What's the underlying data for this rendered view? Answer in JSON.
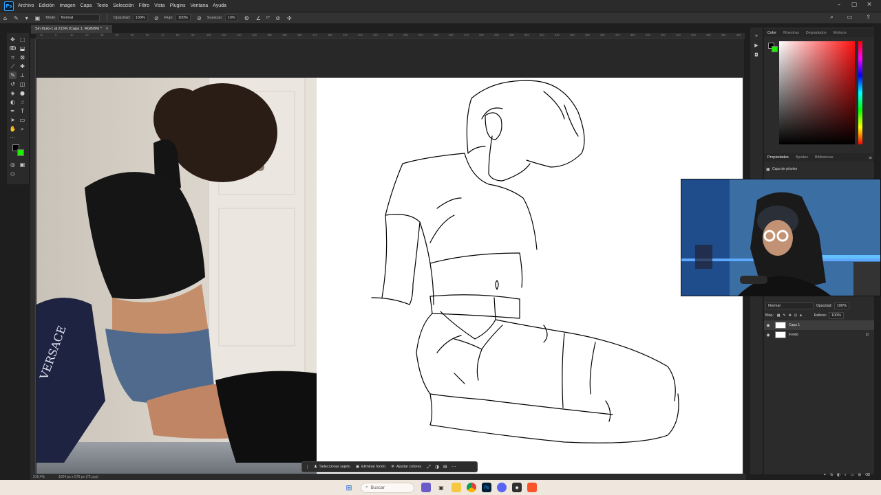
{
  "app": {
    "logo": "Ps"
  },
  "menu": [
    "Archivo",
    "Edición",
    "Imagen",
    "Capa",
    "Texto",
    "Selección",
    "Filtro",
    "Vista",
    "Plugins",
    "Ventana",
    "Ayuda"
  ],
  "options": {
    "mode_label": "Modo:",
    "mode_value": "Normal",
    "opacity_label": "Opacidad:",
    "opacity_value": "100%",
    "flow_label": "Flujo:",
    "flow_value": "100%",
    "smoothing_label": "Suavizar:",
    "smoothing_value": "10%",
    "angle_value": "0°"
  },
  "document": {
    "tab_title": "Sin título-1 al 216% (Capa 1, RGB/8#) *",
    "close": "×"
  },
  "ruler_ticks": [
    "10",
    "0",
    "10",
    "20",
    "30",
    "40",
    "50",
    "60",
    "70",
    "80",
    "90",
    "100",
    "110",
    "120",
    "130",
    "140",
    "150",
    "160",
    "170",
    "180",
    "190",
    "200",
    "210",
    "220",
    "230",
    "240",
    "250",
    "260",
    "270",
    "280",
    "290",
    "300",
    "310",
    "320",
    "330",
    "340",
    "350",
    "360",
    "370",
    "380",
    "390",
    "400",
    "410",
    "420",
    "430",
    "440",
    "450"
  ],
  "status": {
    "zoom": "216,4%",
    "size": "1024 px x 576 px (72 ppp)"
  },
  "task_bar": {
    "select_subject": "Seleccionar sujeto",
    "remove_bg": "Eliminar fondo",
    "adjust_colors": "Ajustar colores",
    "more": "···"
  },
  "color_panel": {
    "tabs": [
      "Color",
      "Muestras",
      "Degradados",
      "Motivos"
    ],
    "fg": "#000000",
    "bg": "#1cf000"
  },
  "props_panel": {
    "tabs": [
      "Propiedades",
      "Ajustes",
      "Bibliotecas"
    ],
    "layer_type": "Capa de píxeles"
  },
  "layers_panel": {
    "blend": "Normal",
    "opacity_label": "Opacidad:",
    "opacity": "100%",
    "lock_label": "Bloq.:",
    "fill_label": "Relleno:",
    "fill": "100%",
    "layers": [
      {
        "name": "Capa 1",
        "selected": true
      },
      {
        "name": "Fondo",
        "selected": false
      }
    ]
  },
  "taskbar": {
    "search_placeholder": "Buscar"
  }
}
